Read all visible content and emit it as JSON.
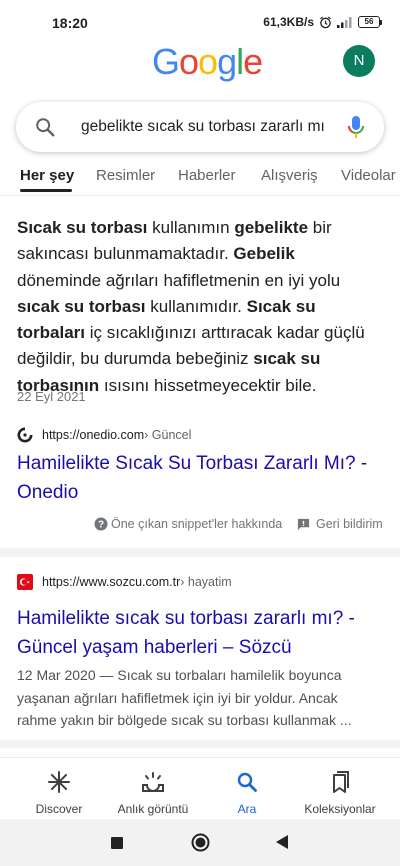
{
  "status_bar": {
    "time": "18:20",
    "network_speed": "61,3KB/s",
    "battery": "56"
  },
  "logo": {
    "text": "Google",
    "colors": [
      "#4285F4",
      "#EA4335",
      "#FBBC05",
      "#4285F4",
      "#34A853",
      "#EA4335"
    ]
  },
  "avatar": {
    "initial": "N",
    "color": "#0b7d5f"
  },
  "search": {
    "query": "gebelikte sıcak su torbası zararlı mı"
  },
  "tabs": [
    {
      "label": "Her şey",
      "active": true
    },
    {
      "label": "Resimler"
    },
    {
      "label": "Haberler"
    },
    {
      "label": "Alışveriş"
    },
    {
      "label": "Videolar"
    }
  ],
  "featured_snippet": {
    "text_parts": [
      {
        "t": "Sıcak su torbası",
        "b": true
      },
      {
        "t": " kullanımın "
      },
      {
        "t": "gebelikte",
        "b": true
      },
      {
        "t": " bir sakıncası bulunmamaktadır. "
      },
      {
        "t": "Gebelik",
        "b": true
      },
      {
        "t": " döneminde ağrıları hafifletmenin en iyi yolu "
      },
      {
        "t": "sıcak su torbası",
        "b": true
      },
      {
        "t": " kullanımıdır. "
      },
      {
        "t": "Sıcak su torbaları",
        "b": true
      },
      {
        "t": " iç sıcaklığınızı arttıracak kadar güçlü değildir, bu durumda bebeğiniz "
      },
      {
        "t": "sıcak su torbasının",
        "b": true
      },
      {
        "t": " ısısını hissetmeyecektir bile."
      }
    ],
    "date": "22 Eyl 2021",
    "source_url": "https://onedio.com",
    "source_path": " › Güncel",
    "title": "Hamilelikte Sıcak Su Torbası Zararlı Mı? - Onedio",
    "about_label": "Öne çıkan snippet'ler hakkında",
    "feedback_label": "Geri bildirim"
  },
  "result_2": {
    "source_url": "https://www.sozcu.com.tr",
    "source_path": " › hayatim",
    "title": "Hamilelikte sıcak su torbası zararlı mı? - Güncel yaşam haberleri – Sözcü",
    "description": "12 Mar 2020 — Sıcak su torbaları hamilelik boyunca yaşanan ağrıları hafifletmek için iyi bir yoldur. Ancak rahme yakın bir bölgede sıcak su torbası kullanmak ..."
  },
  "bottom_nav": [
    {
      "label": "Discover",
      "icon": "asterisk-icon"
    },
    {
      "label": "Anlık görüntü",
      "icon": "snapshot-icon"
    },
    {
      "label": "Ara",
      "icon": "search-icon",
      "active": true
    },
    {
      "label": "Koleksiyonlar",
      "icon": "collections-icon"
    }
  ],
  "colors": {
    "link": "#1a0dab",
    "accent": "#1967d2"
  }
}
